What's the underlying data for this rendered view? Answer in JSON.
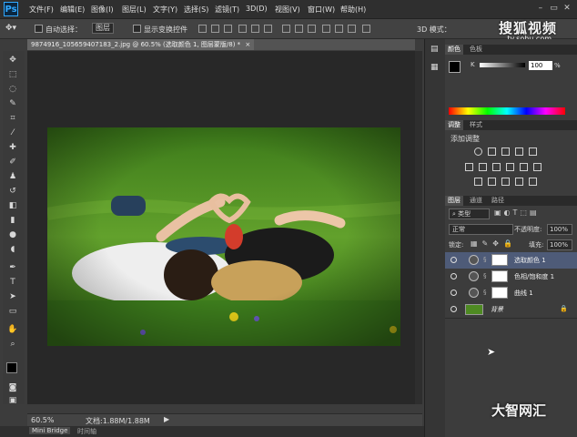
{
  "app": {
    "logo": "Ps"
  },
  "menu": [
    "文件(F)",
    "编辑(E)",
    "图像(I)",
    "图层(L)",
    "文字(Y)",
    "选择(S)",
    "滤镜(T)",
    "3D(D)",
    "视图(V)",
    "窗口(W)",
    "帮助(H)"
  ],
  "window_controls": {
    "minimize": "–",
    "restore": "▭",
    "close": "✕"
  },
  "options": {
    "auto_select_label": "自动选择：",
    "auto_select_value": "图层",
    "show_transform_label": "显示变换控件",
    "mode_3d_label": "3D 模式："
  },
  "watermark": {
    "brand": "搜狐视频",
    "url": "tv.sohu.com"
  },
  "document": {
    "tab_label": "9874916_105659407183_2.jpg @ 60.5% (选取颜色 1, 图层蒙版/8) *",
    "tab_close": "×"
  },
  "status": {
    "zoom": "60.5%",
    "doc_info": "文档:1.88M/1.88M"
  },
  "bottom_tabs": [
    "Mini Bridge",
    "时间轴"
  ],
  "color_panel": {
    "tabs": [
      "颜色",
      "色板"
    ],
    "channel_label": "K",
    "value": "100",
    "unit": "%"
  },
  "adjustments_panel": {
    "tabs": [
      "调整",
      "样式"
    ],
    "title": "添加调整"
  },
  "layers_panel": {
    "tabs": [
      "图层",
      "通道",
      "路径"
    ],
    "filter_kind": "类型",
    "blend_mode": "正常",
    "opacity_label": "不透明度:",
    "opacity_value": "100%",
    "lock_label": "锁定:",
    "fill_label": "填充:",
    "fill_value": "100%",
    "layers": [
      {
        "name": "选取颜色 1",
        "selected": true
      },
      {
        "name": "色相/饱和度 1",
        "selected": false
      },
      {
        "name": "曲线 1",
        "selected": false
      },
      {
        "name": "背景",
        "selected": false
      }
    ]
  },
  "corner_logo": "大智网汇"
}
